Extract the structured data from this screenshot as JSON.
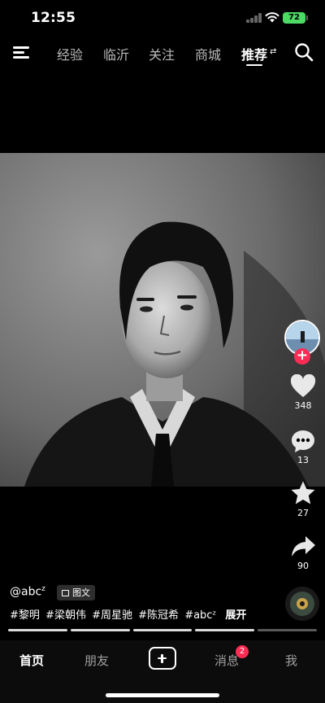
{
  "status_bar": {
    "time": "12:55",
    "battery": "72"
  },
  "top_nav": {
    "tabs": [
      {
        "label": "经验",
        "active": false
      },
      {
        "label": "临沂",
        "active": false
      },
      {
        "label": "关注",
        "active": false
      },
      {
        "label": "商城",
        "active": false
      },
      {
        "label": "推荐",
        "active": true
      }
    ],
    "tab_switch_glyph": "⇄"
  },
  "actions": {
    "follow_glyph": "+",
    "likes": "348",
    "comments": "13",
    "favorites": "27",
    "shares": "90"
  },
  "caption": {
    "author": "@abc",
    "author_sup": "z",
    "type_badge": "图文",
    "hashtags": [
      "#黎明",
      "#梁朝伟",
      "#周星驰",
      "#陈冠希",
      "#abcᶻ"
    ],
    "expand": "展开"
  },
  "carousel": {
    "total_images": 5,
    "current_image": 4
  },
  "bottom_nav": {
    "tabs": [
      {
        "label": "首页",
        "active": true
      },
      {
        "label": "朋友",
        "active": false
      },
      {
        "label": "消息",
        "active": false
      },
      {
        "label": "我",
        "active": false
      }
    ],
    "messages_badge": "2"
  },
  "colors": {
    "accent": "#fe2c55",
    "battery": "#4cd964",
    "background": "#000000"
  }
}
